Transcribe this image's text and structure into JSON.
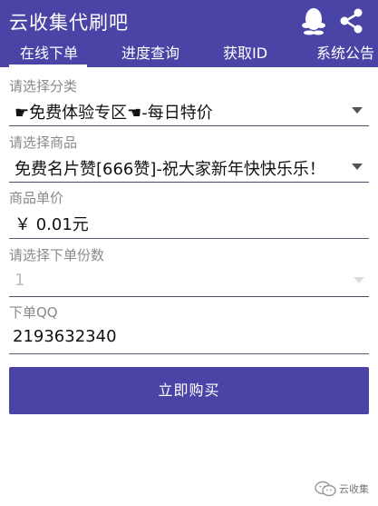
{
  "app": {
    "title": "云收集代刷吧"
  },
  "header_icons": {
    "qq": "qq-penguin-icon",
    "share": "share-icon"
  },
  "tabs": [
    {
      "label": "在线下单",
      "active": true
    },
    {
      "label": "进度查询",
      "active": false
    },
    {
      "label": "获取ID",
      "active": false
    },
    {
      "label": "系统公告",
      "active": false
    }
  ],
  "form": {
    "category": {
      "label": "请选择分类",
      "value": "☛免费体验专区☚-每日特价"
    },
    "product": {
      "label": "请选择商品",
      "value": "免费名片赞[666赞]-祝大家新年快快乐乐！"
    },
    "unit_price": {
      "label": "商品单价",
      "value": "￥ 0.01元"
    },
    "quantity": {
      "label": "请选择下单份数",
      "value": "1"
    },
    "qq": {
      "label": "下单QQ",
      "value": "2193632340"
    },
    "submit_label": "立即购买"
  },
  "watermark": {
    "text": "云收集"
  },
  "colors": {
    "primary": "#4a44a6",
    "label": "#8a8a8a",
    "text": "#111111"
  }
}
